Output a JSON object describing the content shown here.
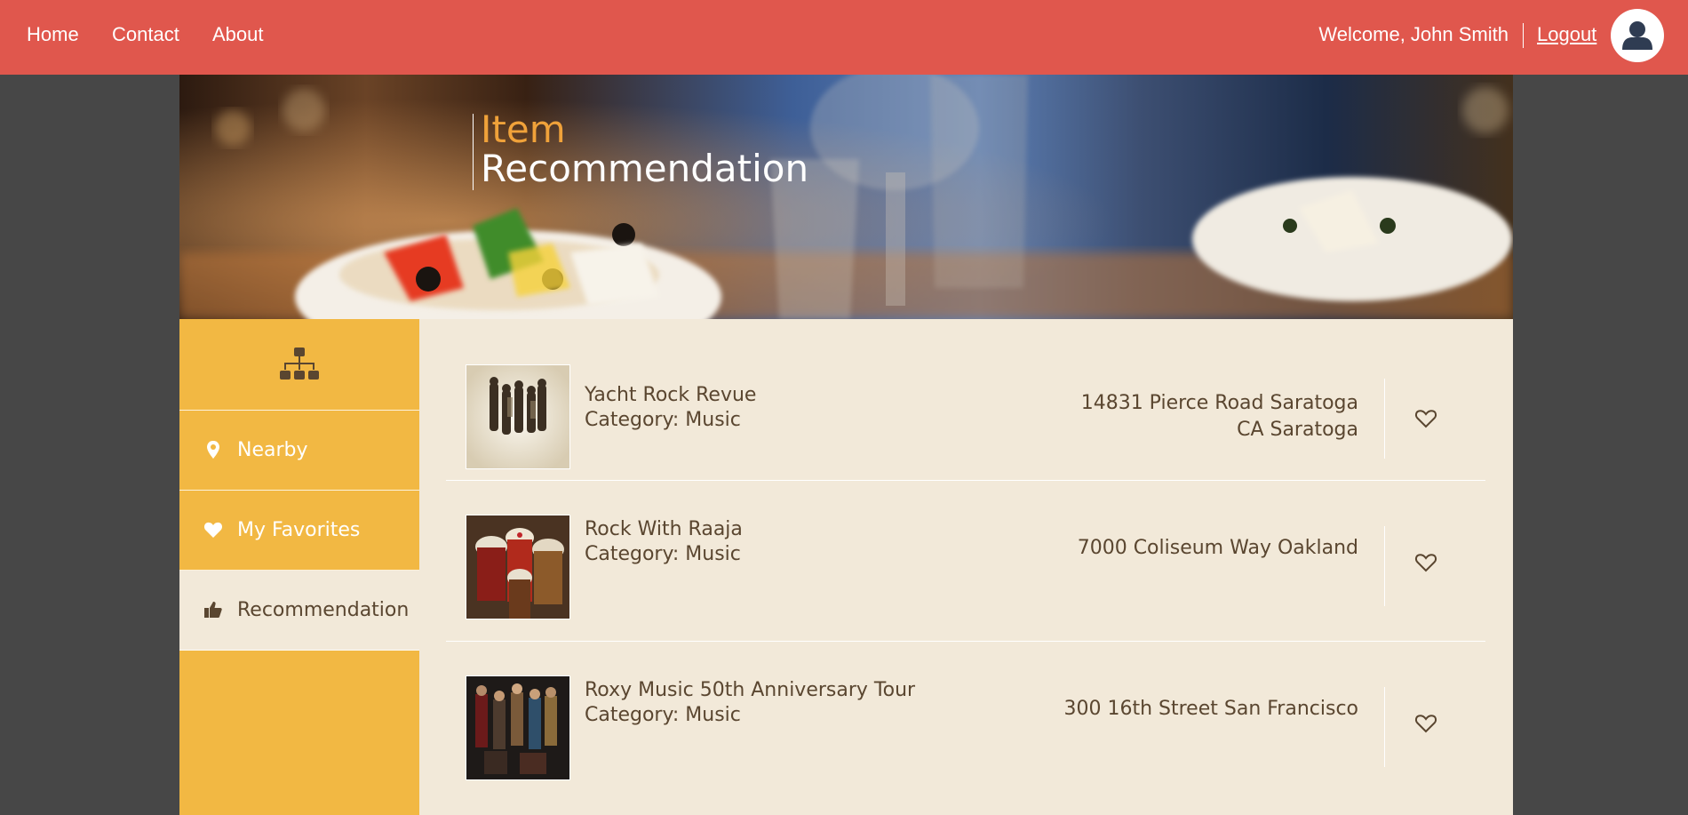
{
  "nav": {
    "home": "Home",
    "contact": "Contact",
    "about": "About",
    "welcome": "Welcome, John Smith",
    "logout": "Logout"
  },
  "hero": {
    "title_top": "Item",
    "title_bottom": "Recommendation"
  },
  "sidebar": {
    "top_icon": "sitemap-icon",
    "items": [
      {
        "label": "Nearby",
        "icon": "map-pin-icon"
      },
      {
        "label": "My Favorites",
        "icon": "heart-icon"
      },
      {
        "label": "Recommendation",
        "icon": "thumbs-up-icon"
      }
    ],
    "active": "Recommendation"
  },
  "items": [
    {
      "name": "Yacht Rock Revue",
      "category": "Category: Music",
      "address_line1": "14831 Pierce Road Saratoga",
      "address_line2": "CA Saratoga",
      "favorite_icon": "heart-outline-icon"
    },
    {
      "name": "Rock With Raaja",
      "category": "Category: Music",
      "address_line1": "7000 Coliseum Way Oakland",
      "favorite_icon": "heart-outline-icon"
    },
    {
      "name": "Roxy Music 50th Anniversary Tour",
      "category": "Category: Music",
      "address_line1": "300 16th Street San Francisco",
      "favorite_icon": "heart-outline-icon"
    }
  ],
  "colors": {
    "topbar": "#e0574d",
    "sidebar": "#f2b843",
    "content_bg": "#f2e9d9",
    "title_accent": "#f0a23a",
    "text": "#5a4630",
    "page_bg": "#474747"
  }
}
